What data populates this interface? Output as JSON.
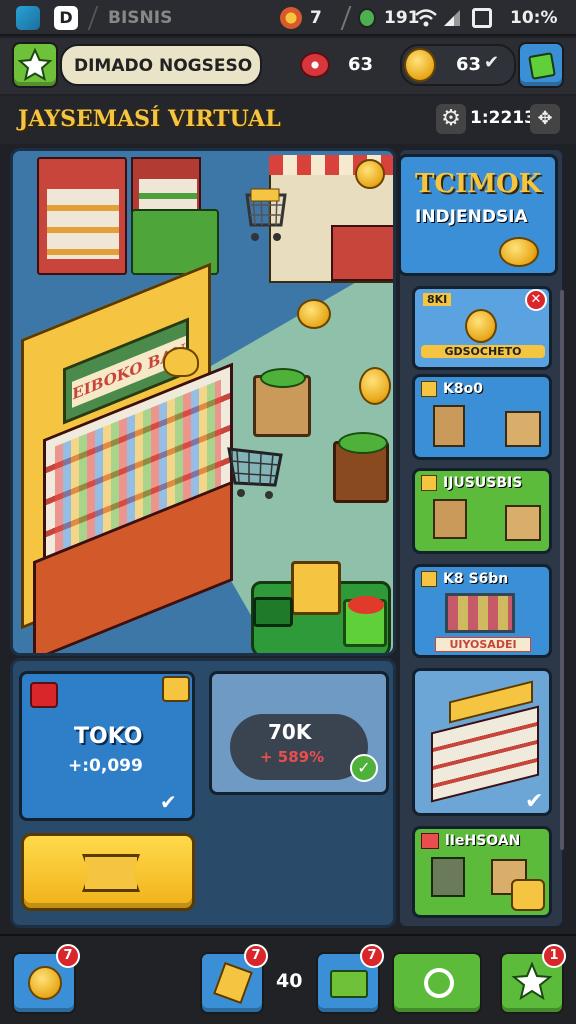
{
  "status_bar": {
    "app_name": "BISNIS",
    "notif_count": "7",
    "data_value": "191",
    "time": "10:%"
  },
  "top_bar": {
    "player_name": "DIMADO NOGSESO",
    "gems": "63",
    "coins": "63"
  },
  "title_row": {
    "title": "JAYSEMASÍ VIRTUAL",
    "timer": "1:2213"
  },
  "side_panel": {
    "header_title": "TCIMOK",
    "header_subtitle": "INDJENDSIA",
    "cards": [
      {
        "label": "8KI",
        "sub": "GDSOCHETO"
      },
      {
        "label": "K8o0",
        "sub": ""
      },
      {
        "label": "IJUSUSBIS",
        "sub": ""
      },
      {
        "label": "K8 S6bn",
        "sub": "UIYOSADEI"
      },
      {
        "label": "",
        "sub": ""
      },
      {
        "label": "lIeHSOAN",
        "sub": ""
      }
    ]
  },
  "board": {
    "shop_sign": "EIBOKO BAN"
  },
  "panels": {
    "left_title": "TOKO",
    "left_value": "+:0,099",
    "right_title": "70K",
    "right_value": "+ 589%"
  },
  "bottom_bar": {
    "badge1": "7",
    "badge2": "7",
    "badge3": "7",
    "badge4": "1",
    "center_count": "40"
  },
  "colors": {
    "gold": "#f5c542",
    "green": "#5cbb3a",
    "blue": "#2f7fc8",
    "red": "#d8262b"
  }
}
